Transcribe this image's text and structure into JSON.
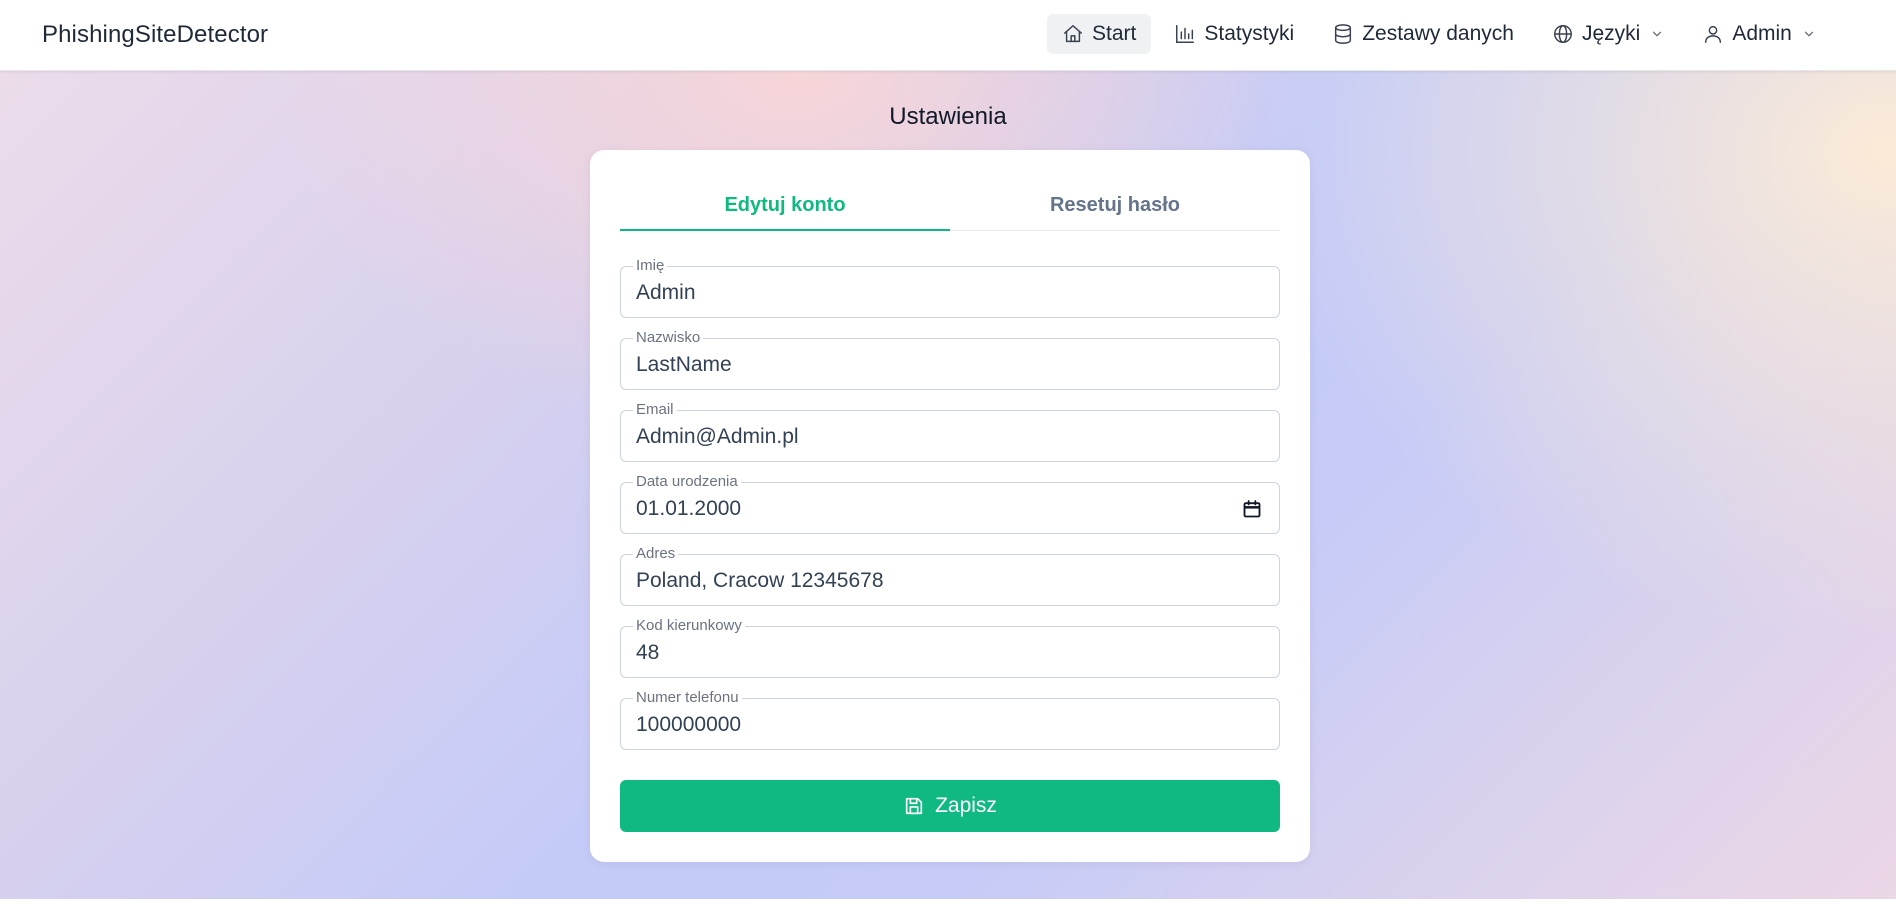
{
  "app": {
    "brand": "PhishingSiteDetector"
  },
  "nav": {
    "items": [
      {
        "label": "Start",
        "icon": "home-icon",
        "active": true
      },
      {
        "label": "Statystyki",
        "icon": "bar-chart-icon"
      },
      {
        "label": "Zestawy danych",
        "icon": "database-icon"
      },
      {
        "label": "Języki",
        "icon": "globe-icon",
        "dropdown": true
      },
      {
        "label": "Admin",
        "icon": "user-icon",
        "dropdown": true
      }
    ]
  },
  "page": {
    "title": "Ustawienia"
  },
  "tabs": [
    {
      "label": "Edytuj konto",
      "active": true
    },
    {
      "label": "Resetuj hasło",
      "active": false
    }
  ],
  "form": {
    "fields": [
      {
        "label": "Imię",
        "value": "Admin"
      },
      {
        "label": "Nazwisko",
        "value": "LastName"
      },
      {
        "label": "Email",
        "value": "Admin@Admin.pl"
      },
      {
        "label": "Data urodzenia",
        "value": "01.01.2000",
        "icon": "calendar-icon"
      },
      {
        "label": "Adres",
        "value": "Poland, Cracow 12345678"
      },
      {
        "label": "Kod kierunkowy",
        "value": "48"
      },
      {
        "label": "Numer telefonu",
        "value": "100000000"
      }
    ],
    "save_label": "Zapisz",
    "save_icon": "save-icon"
  },
  "colors": {
    "accent": "#10b981",
    "text": "#1f2937",
    "muted": "#64748b"
  }
}
